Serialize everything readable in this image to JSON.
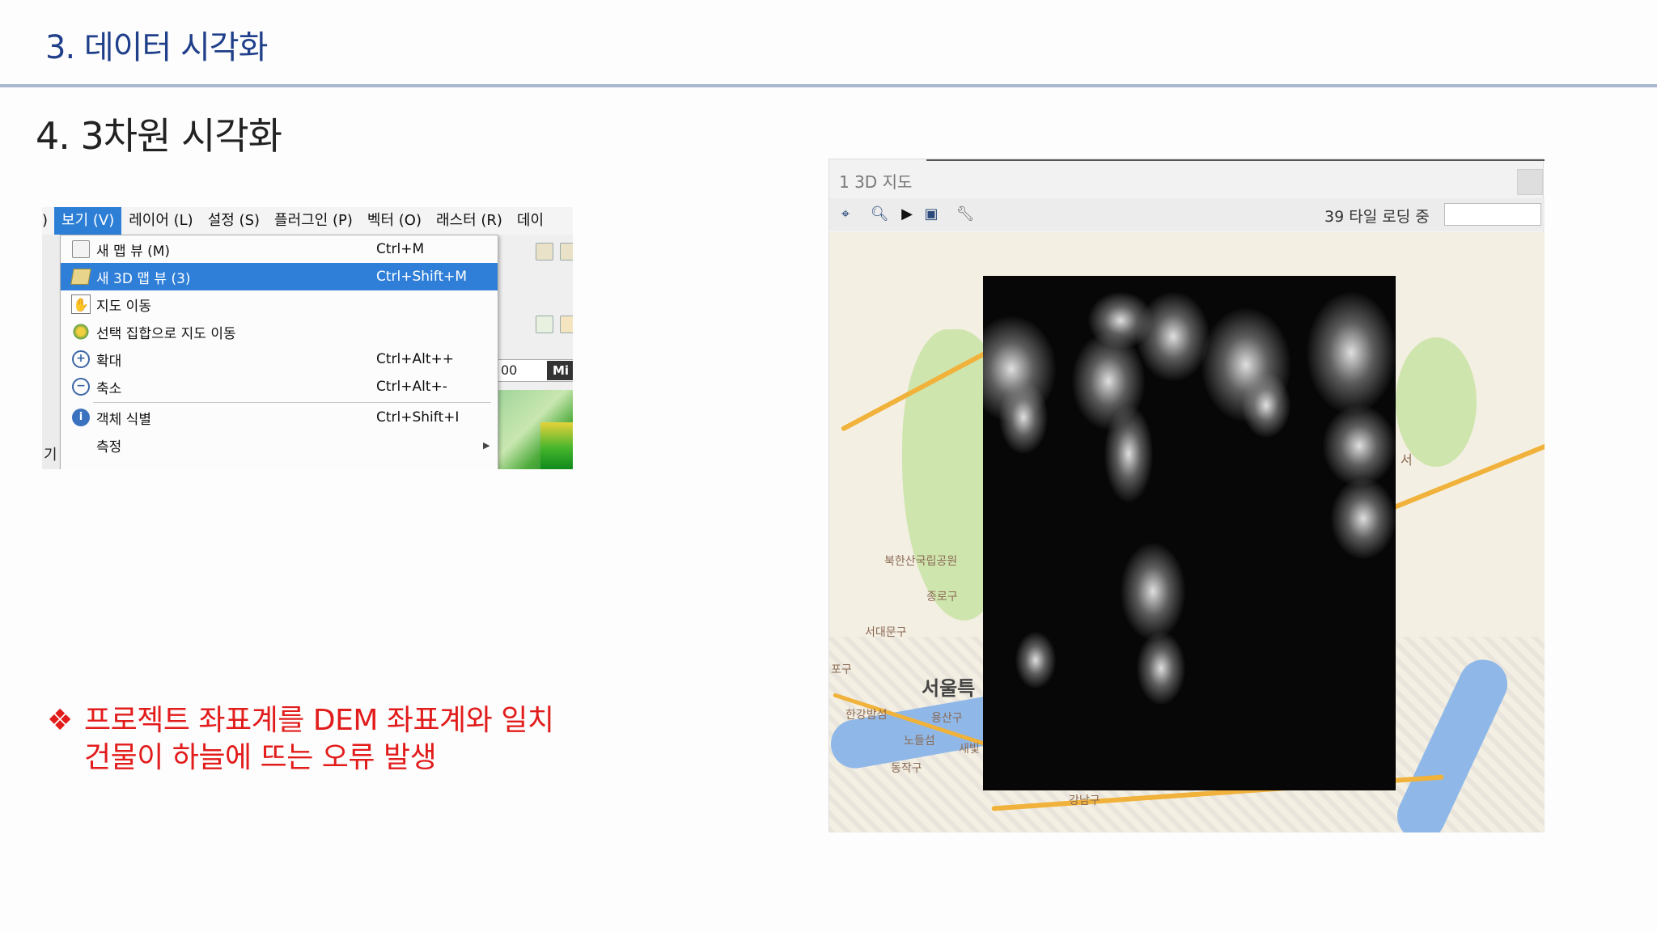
{
  "header": {
    "section_title": "3. 데이터 시각화",
    "slide_subtitle": "4. 3차원 시각화"
  },
  "menu_screenshot": {
    "menubar": {
      "lead": ")",
      "items": [
        {
          "label": "보기 (V)",
          "active": true
        },
        {
          "label": "레이어 (L)",
          "active": false
        },
        {
          "label": "설정 (S)",
          "active": false
        },
        {
          "label": "플러그인 (P)",
          "active": false
        },
        {
          "label": "벡터 (O)",
          "active": false
        },
        {
          "label": "래스터 (R)",
          "active": false
        },
        {
          "label": "데이",
          "active": false
        }
      ]
    },
    "items": [
      {
        "icon": "new-map-view-icon",
        "label": "새 맵 뷰 (M)",
        "shortcut": "Ctrl+M"
      },
      {
        "icon": "new-3d-map-view-icon",
        "label": "새 3D 맵 뷰 (3)",
        "shortcut": "Ctrl+Shift+M",
        "highlighted": true
      },
      {
        "icon": "pan-hand-icon",
        "label": "지도 이동",
        "shortcut": ""
      },
      {
        "icon": "pan-to-selection-icon",
        "label": "선택 집합으로 지도 이동",
        "shortcut": ""
      },
      {
        "icon": "zoom-in-icon",
        "label": "확대",
        "shortcut": "Ctrl+Alt++"
      },
      {
        "icon": "zoom-out-icon",
        "label": "축소",
        "shortcut": "Ctrl+Alt+-"
      },
      {
        "icon": "identify-features-icon",
        "label": "객체 식별",
        "shortcut": "Ctrl+Shift+I"
      },
      {
        "icon": "",
        "label": "측정",
        "shortcut": "",
        "submenu": true
      }
    ],
    "background": {
      "spin_value": "00",
      "spin_suffix": "Mi",
      "left_char": "기"
    }
  },
  "note": {
    "bullet": "❖",
    "lines": [
      "프로젝트 좌표계를 DEM 좌표계와 일치",
      "건물이 하늘에 뜨는 오류 발생"
    ],
    "color": "#e21b1b"
  },
  "map_window": {
    "title": "1 3D 지도",
    "toolbar_icons": [
      "camera-control-icon",
      "identify-icon",
      "play-icon",
      "export-icon",
      "configure-icon"
    ],
    "status": "39 타일 로딩 중",
    "map_labels": [
      "북한산국립공원",
      "종로구",
      "서대문구",
      "포구",
      "서울특",
      "한강밤섬",
      "용산구",
      "동작구",
      "노들섬",
      "새빛",
      "강남구",
      "서"
    ]
  }
}
